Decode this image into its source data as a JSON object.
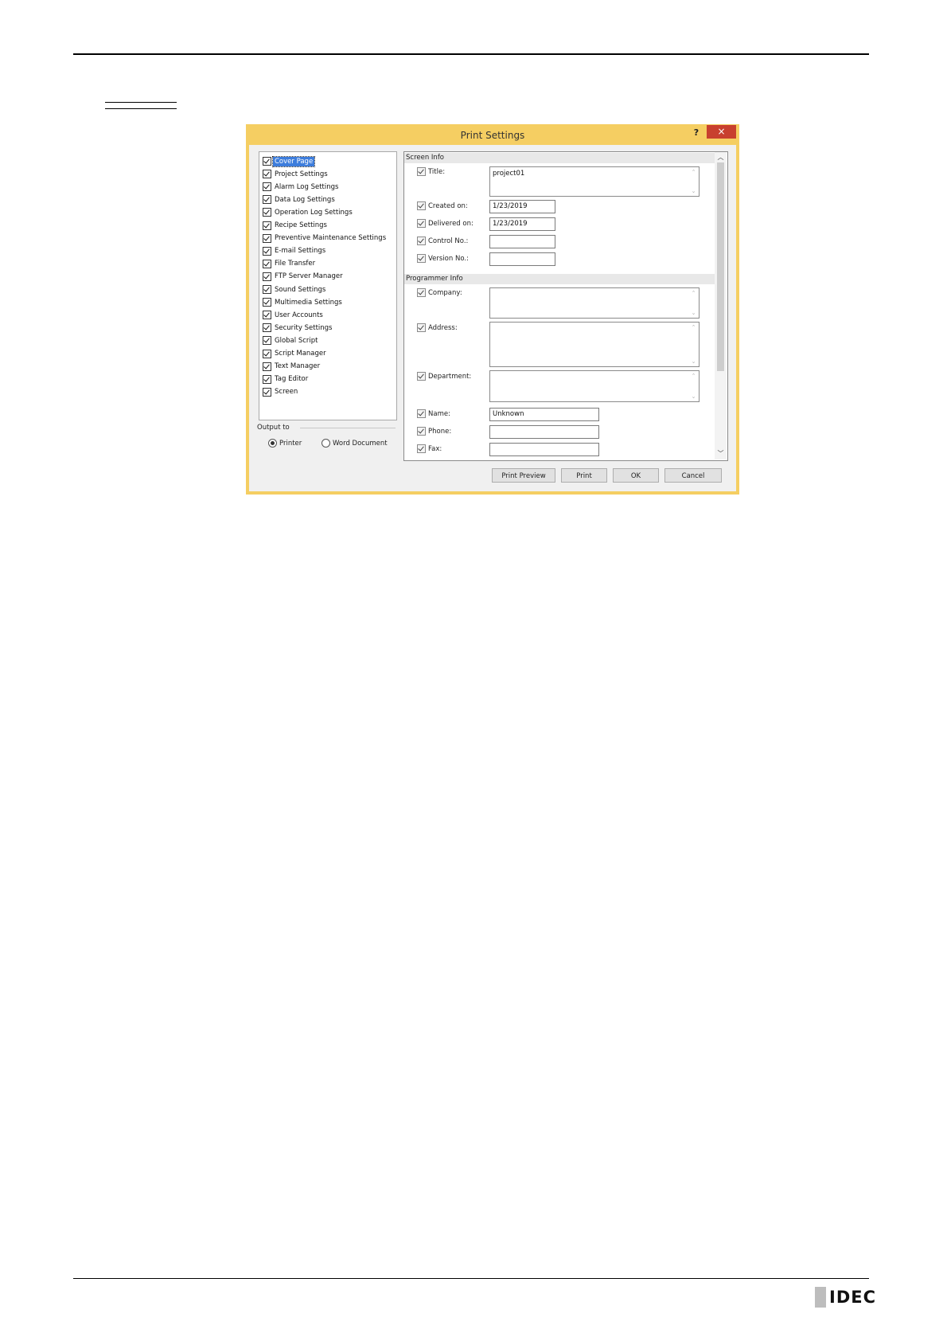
{
  "dialog": {
    "title": "Print Settings",
    "help_label": "?",
    "close_label": "×"
  },
  "tree": {
    "items": [
      {
        "label": "Cover Page",
        "checked": true,
        "selected": true
      },
      {
        "label": "Project Settings",
        "checked": true
      },
      {
        "label": "Alarm Log Settings",
        "checked": true
      },
      {
        "label": "Data Log Settings",
        "checked": true
      },
      {
        "label": "Operation Log Settings",
        "checked": true
      },
      {
        "label": "Recipe Settings",
        "checked": true
      },
      {
        "label": "Preventive Maintenance Settings",
        "checked": true
      },
      {
        "label": "E-mail Settings",
        "checked": true
      },
      {
        "label": "File Transfer",
        "checked": true
      },
      {
        "label": "FTP Server Manager",
        "checked": true
      },
      {
        "label": "Sound Settings",
        "checked": true
      },
      {
        "label": "Multimedia Settings",
        "checked": true
      },
      {
        "label": "User Accounts",
        "checked": true
      },
      {
        "label": "Security Settings",
        "checked": true
      },
      {
        "label": "Global Script",
        "checked": true
      },
      {
        "label": "Script Manager",
        "checked": true
      },
      {
        "label": "Text Manager",
        "checked": true
      },
      {
        "label": "Tag Editor",
        "checked": true
      },
      {
        "label": "Screen",
        "checked": true
      }
    ]
  },
  "output": {
    "label": "Output to",
    "printer_label": "Printer",
    "word_label": "Word Document",
    "selected": "Printer"
  },
  "screen_info": {
    "header": "Screen Info",
    "title_label": "Title:",
    "title_value": "project01",
    "created_label": "Created on:",
    "created_value": "1/23/2019",
    "delivered_label": "Delivered on:",
    "delivered_value": "1/23/2019",
    "control_label": "Control No.:",
    "control_value": "",
    "version_label": "Version No.:",
    "version_value": ""
  },
  "programmer_info": {
    "header": "Programmer Info",
    "company_label": "Company:",
    "address_label": "Address:",
    "department_label": "Department:",
    "name_label": "Name:",
    "name_value": "Unknown",
    "phone_label": "Phone:",
    "phone_value": "",
    "fax_label": "Fax:",
    "fax_value": ""
  },
  "buttons": {
    "print_preview": "Print Preview",
    "print": "Print",
    "ok": "OK",
    "cancel": "Cancel"
  },
  "footer": {
    "logo_text": "IDEC"
  }
}
